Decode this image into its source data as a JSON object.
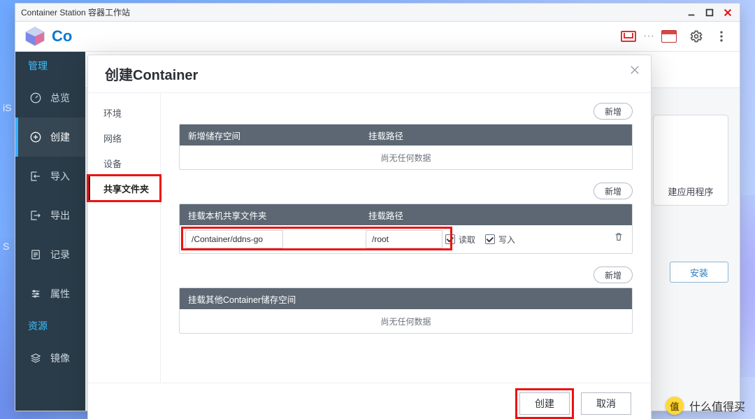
{
  "titlebar": {
    "title": "Container Station 容器工作站"
  },
  "appChrome": {
    "name_fragment": "Co"
  },
  "nav": {
    "sections": {
      "manage": "管理",
      "resources": "资源"
    },
    "items": {
      "overview": "总览",
      "create": "创建",
      "import": "导入",
      "export": "导出",
      "logs": "记录",
      "properties": "属性",
      "images": "镜像"
    }
  },
  "back": {
    "tile_label": "建应用程序",
    "install_label": "安装"
  },
  "modal": {
    "title": "创建Container",
    "tabs": {
      "env": "环境",
      "network": "网络",
      "device": "设备",
      "shared": "共享文件夹"
    },
    "add_label": "新增",
    "sections": {
      "newStorage": {
        "col_a": "新增储存空间",
        "col_b": "挂载路径",
        "empty": "尚无任何数据"
      },
      "hostShare": {
        "col_a": "挂载本机共享文件夹",
        "col_b": "挂载路径"
      },
      "otherStore": {
        "col_a": "挂载其他Container储存空间",
        "empty": "尚无任何数据"
      }
    },
    "row": {
      "host_path": "/Container/ddns-go",
      "mount_path": "/root",
      "read_label": "读取",
      "write_label": "写入",
      "read_checked": true,
      "write_checked": true
    },
    "footer": {
      "create": "创建",
      "cancel": "取消"
    }
  },
  "watermark": {
    "badge": "值",
    "text": "什么值得买"
  }
}
